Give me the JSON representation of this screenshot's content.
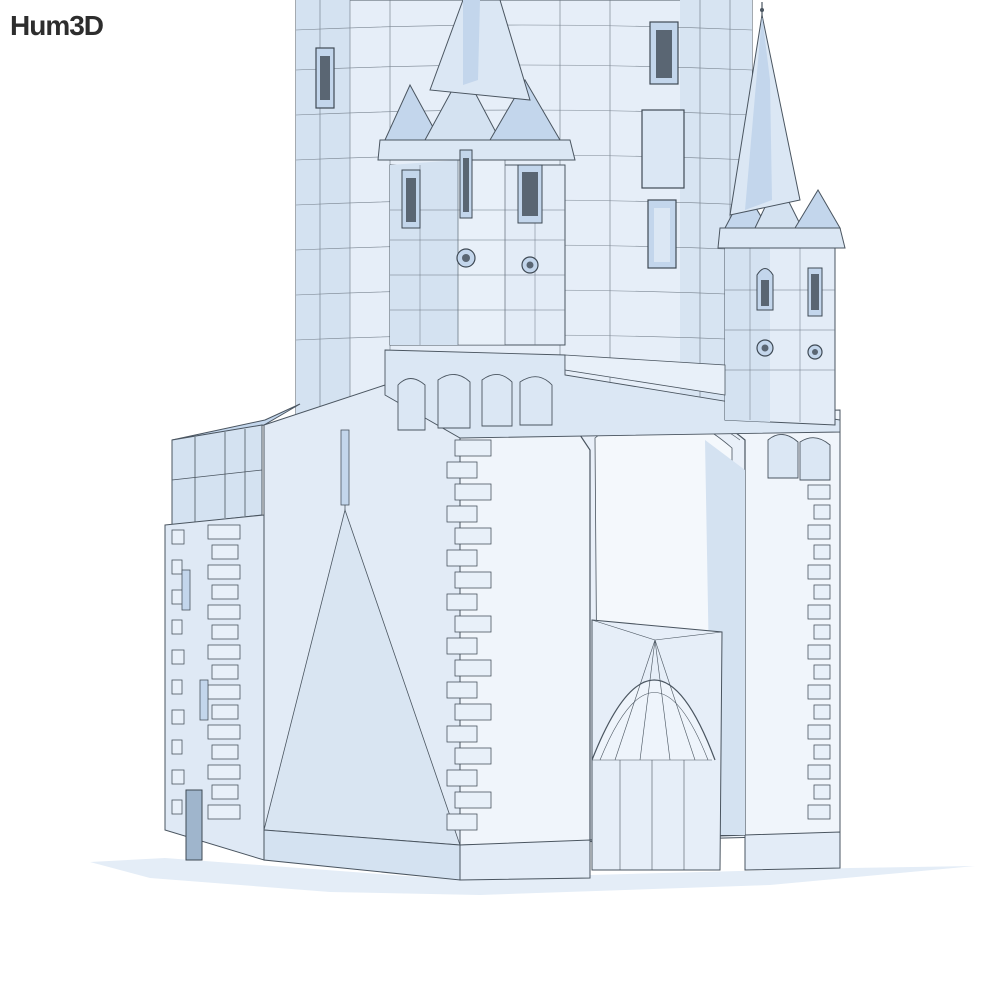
{
  "watermark": {
    "text": "Hum3D"
  },
  "scene": {
    "subject": "medieval-gate-tower-wireframe-render",
    "palette": {
      "light": "#eef4fb",
      "mid": "#dbe7f4",
      "shade": "#c3d6ec",
      "dark": "#aac3df",
      "line": "#4a5560",
      "ground": "#e4edf7"
    }
  }
}
